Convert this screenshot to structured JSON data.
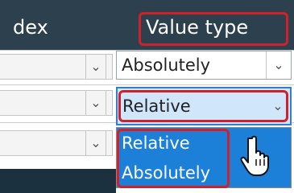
{
  "header": {
    "left_label": "dex",
    "right_label": "Value type"
  },
  "rows": [
    {
      "value": "Absolutely"
    },
    {
      "value": "Relative"
    }
  ],
  "dropdown": {
    "options": [
      "Relative",
      "Absolutely"
    ],
    "hovered": "Relative"
  },
  "icons": {
    "chevron": "chevron-down-icon",
    "cursor": "hand-pointer-icon"
  },
  "colors": {
    "header_bg": "#2c414d",
    "highlight": "#d0202c",
    "selection": "#1c7fd8",
    "focus_bg": "#cfe6fb"
  }
}
